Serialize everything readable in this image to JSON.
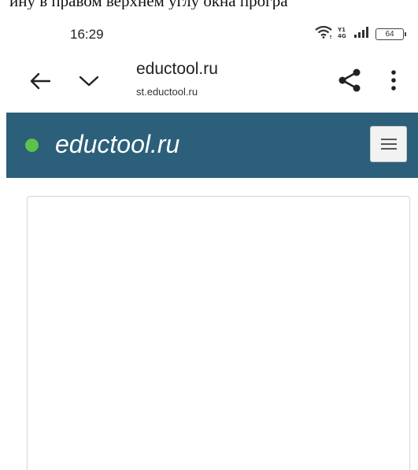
{
  "document_text": "ину в правом верхнем углу окна програ",
  "status_bar": {
    "time": "16:29",
    "battery_level": "64",
    "icons": [
      "wifi-icon",
      "hd-signal-icon",
      "cellular-signal-icon",
      "battery-icon"
    ]
  },
  "toolbar": {
    "title": "eductool.ru",
    "subtitle": "st.eductool.ru",
    "icons": [
      "back-arrow-icon",
      "chevron-down-icon",
      "share-icon",
      "more-vert-icon"
    ]
  },
  "site_header": {
    "logo_text": "eductool.ru",
    "colors": {
      "background": "#2c5f7a",
      "dot": "#5cc24a",
      "text": "#ffffff"
    },
    "icons": [
      "hamburger-menu-icon"
    ]
  }
}
